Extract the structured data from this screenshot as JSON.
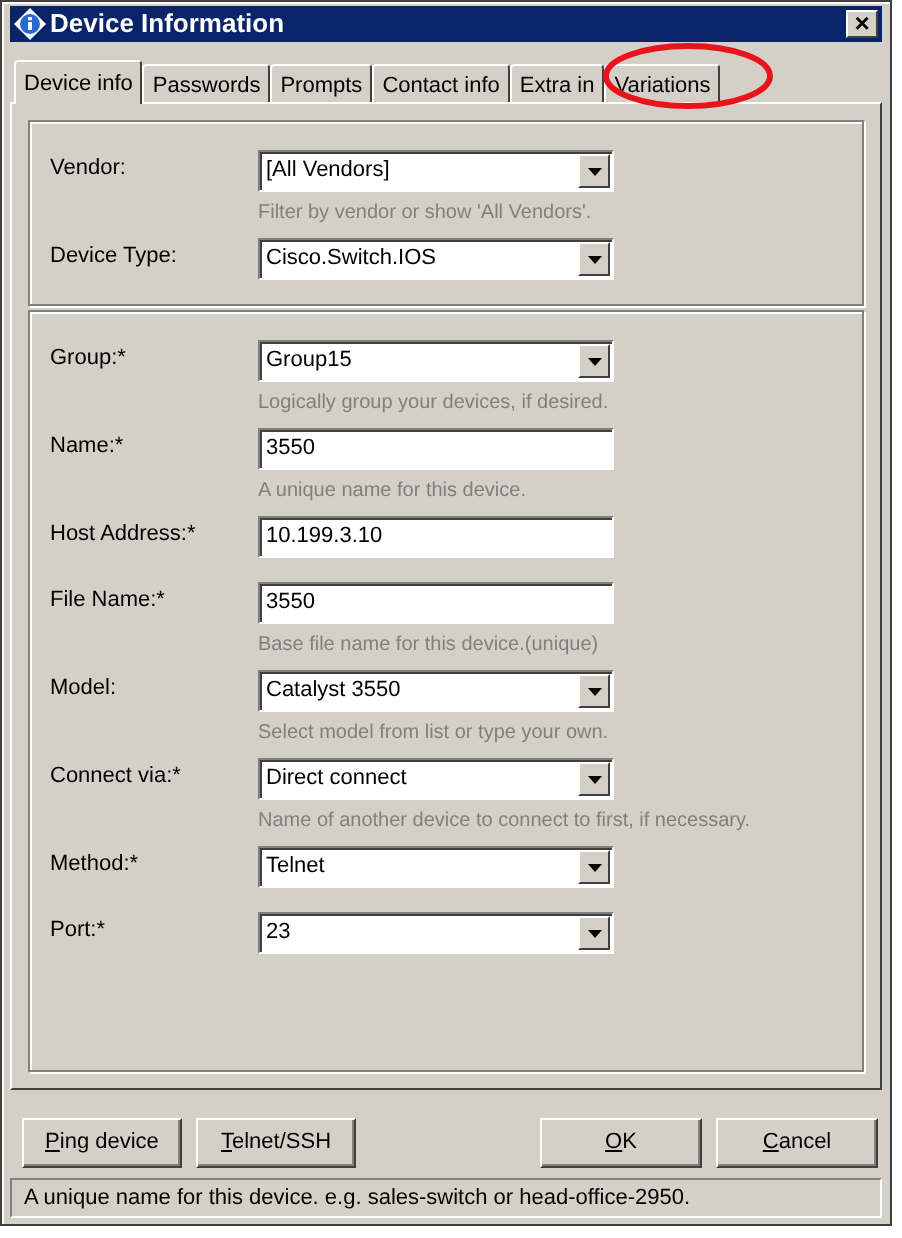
{
  "window": {
    "title": "Device Information",
    "close": "×"
  },
  "tabs": [
    {
      "label": "Device info",
      "selected": true
    },
    {
      "label": "Passwords",
      "selected": false
    },
    {
      "label": "Prompts",
      "selected": false
    },
    {
      "label": "Contact info",
      "selected": false
    },
    {
      "label": "Extra in",
      "selected": false
    },
    {
      "label": "Variations",
      "selected": false,
      "circled": true
    }
  ],
  "groups": [
    {
      "fields": [
        {
          "label": "Vendor:",
          "kind": "combo",
          "value": "[All Vendors]",
          "hint": "Filter by vendor or show 'All Vendors'."
        },
        {
          "label": "Device Type:",
          "kind": "combo",
          "value": "Cisco.Switch.IOS"
        }
      ]
    },
    {
      "fields": [
        {
          "label": "Group:*",
          "kind": "combo",
          "value": "Group15",
          "hint": "Logically group your devices, if desired."
        },
        {
          "label": "Name:*",
          "kind": "text",
          "value": "3550",
          "hint": "A unique name for this device."
        },
        {
          "label": "Host Address:*",
          "kind": "text",
          "value": "10.199.3.10"
        },
        {
          "label": "File Name:*",
          "kind": "text",
          "value": "3550",
          "hint": "Base file name for this device.(unique)"
        },
        {
          "label": "Model:",
          "kind": "combo",
          "value": "Catalyst 3550",
          "hint": "Select model from list or type your own."
        },
        {
          "label": "Connect via:*",
          "kind": "combo",
          "value": "Direct connect",
          "hint": "Name of another device to connect to first, if necessary."
        },
        {
          "label": "Method:*",
          "kind": "combo",
          "value": "Telnet"
        },
        {
          "label": "Port:*",
          "kind": "combo",
          "value": "23"
        }
      ]
    }
  ],
  "buttons_left": [
    {
      "mnemonic": "P",
      "rest": "ing device"
    },
    {
      "mnemonic": "T",
      "rest": "elnet/SSH"
    }
  ],
  "buttons_right": [
    {
      "mnemonic": "O",
      "rest": "K"
    },
    {
      "mnemonic": "C",
      "rest": "ancel"
    }
  ],
  "status_bar": "A unique name for this device. e.g. sales-switch or head-office-2950."
}
